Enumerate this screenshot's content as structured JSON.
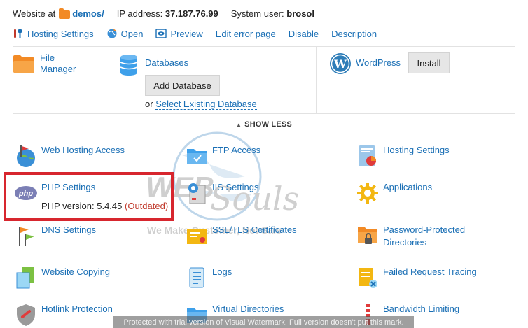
{
  "header": {
    "website_label": "Website at",
    "website_folder": "demos/",
    "ip_label": "IP address:",
    "ip_value": "37.187.76.99",
    "user_label": "System user:",
    "user_value": "brosol"
  },
  "actions": [
    {
      "label": "Hosting Settings",
      "icon": "wrench-icon"
    },
    {
      "label": "Open",
      "icon": "globe-icon"
    },
    {
      "label": "Preview",
      "icon": "eye-icon"
    },
    {
      "label": "Edit error page",
      "icon": ""
    },
    {
      "label": "Disable",
      "icon": ""
    },
    {
      "label": "Description",
      "icon": ""
    }
  ],
  "quick": {
    "file_manager_line1": "File",
    "file_manager_line2": "Manager",
    "databases": "Databases",
    "add_database": "Add Database",
    "or": "or",
    "select_existing": "Select Existing Database",
    "wordpress": "WordPress",
    "install": "Install"
  },
  "show_less": "SHOW LESS",
  "tiles": {
    "web_hosting_access": "Web Hosting Access",
    "ftp_access": "FTP Access",
    "hosting_settings": "Hosting Settings",
    "php_settings": "PHP Settings",
    "php_version_label": "PHP version: 5.4.45",
    "php_outdated": "(Outdated)",
    "iis_settings": "IIS Settings",
    "applications": "Applications",
    "dns_settings": "DNS Settings",
    "ssl_tls": "SSL/TLS Certificates",
    "password_protected_1": "Password-Protected",
    "password_protected_2": "Directories",
    "website_copying": "Website Copying",
    "logs": "Logs",
    "failed_request_tracing": "Failed Request Tracing",
    "hotlink_protection": "Hotlink Protection",
    "virtual_directories": "Virtual Directories",
    "bandwidth_limiting": "Bandwidth Limiting"
  },
  "watermark": {
    "line1": "WEB",
    "line2": "Souls",
    "tagline": "We Make Customer, Not Sale"
  },
  "trial_notice": "Protected with trial version of Visual Watermark. Full version doesn't put this mark.",
  "colors": {
    "link": "#1a6fb5",
    "highlight": "#d7262e",
    "outdated": "#c0392b",
    "folder": "#f28a25"
  }
}
